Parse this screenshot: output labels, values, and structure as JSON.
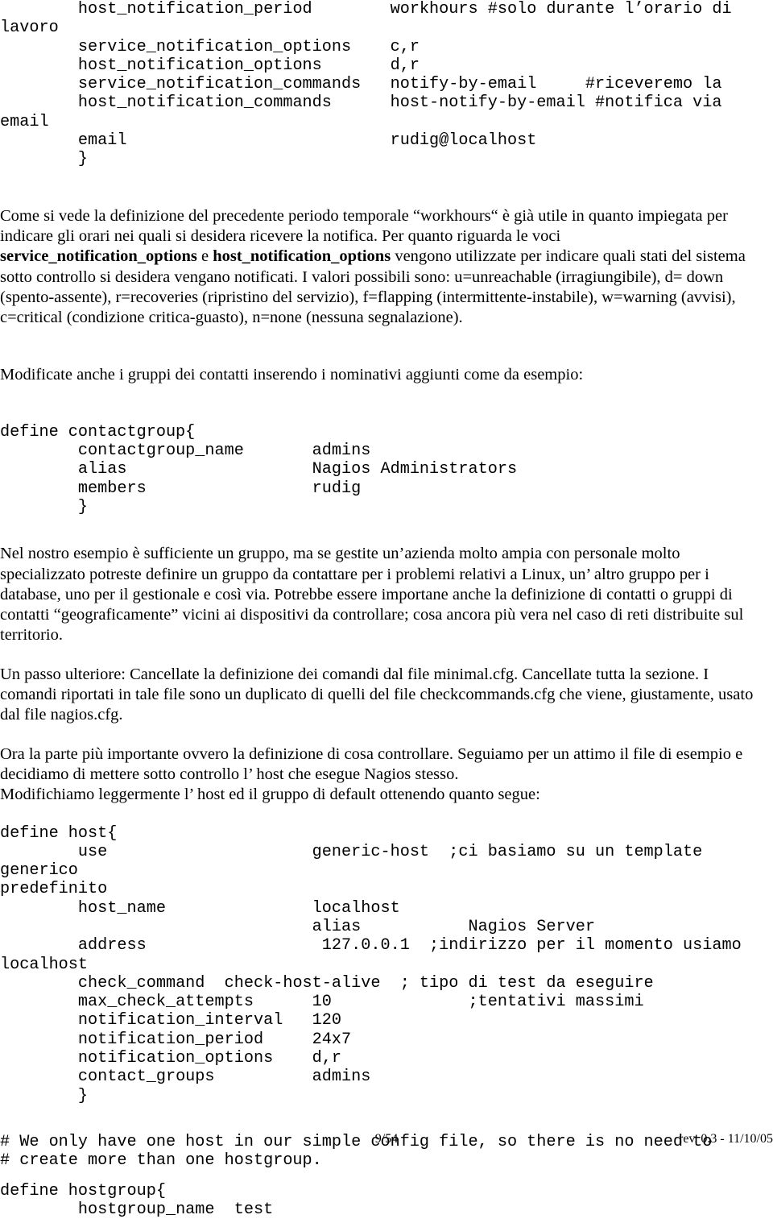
{
  "document": {
    "language": "it",
    "page_label": "9/54",
    "revision": "rev. 0.3 - 11/10/05"
  },
  "blocks": {
    "contact_block": {
      "kind": "code",
      "text": "        host_notification_period        workhours #solo durante l’orario di\nlavoro\n        service_notification_options    c,r\n        host_notification_options       d,r\n        service_notification_commands   notify-by-email     #riceveremo la\n        host_notification_commands      host-notify-by-email #notifica via email\n        email                           rudig@localhost\n        }"
    },
    "para_workhours": {
      "kind": "prose",
      "segments": [
        {
          "text": "Come si vede la definizione del precedente periodo temporale “workhours“ è già utile in quanto impiegata per indicare gli orari nei quali si desidera ricevere la notifica.  Per quanto riguarda le voci ",
          "bold": false
        },
        {
          "text": "service_notification_options",
          "bold": true
        },
        {
          "text": " e ",
          "bold": false
        },
        {
          "text": "host_notification_options",
          "bold": true
        },
        {
          "text": " vengono utilizzate per indicare quali stati del sistema sotto controllo si desidera vengano notificati.  I valori possibili sono: u=unreachable (irragiungibile), d= down (spento-assente), r=recoveries (ripristino del servizio), f=flapping (intermittente-instabile), w=warning (avvisi), c=critical (condizione critica-guasto), n=none (nessuna segnalazione).",
          "bold": false
        }
      ]
    },
    "para_contactgroup_intro": {
      "kind": "prose",
      "segments": [
        {
          "text": "Modificate anche i gruppi dei contatti inserendo i nominativi aggiunti come da esempio:",
          "bold": false
        }
      ]
    },
    "contactgroup_block": {
      "kind": "code",
      "text": "define contactgroup{\n        contactgroup_name       admins\n        alias                   Nagios Administrators\n        members                 rudig\n        }"
    },
    "para_gruppi": {
      "kind": "prose",
      "segments": [
        {
          "text": "Nel nostro esempio è sufficiente un gruppo, ma se gestite un’azienda molto ampia con personale molto specializzato potreste definire un gruppo da contattare per i problemi relativi a Linux, un’ altro gruppo per i database, uno per il gestionale e così via.  Potrebbe essere importane anche la definizione di contatti o gruppi di contatti “geograficamente” vicini ai dispositivi da controllare; cosa ancora più vera nel caso di reti distribuite sul territorio.",
          "bold": false
        }
      ]
    },
    "para_passo_ulteriore": {
      "kind": "prose",
      "segments": [
        {
          "text": "Un passo ulteriore: Cancellate la definizione dei comandi dal file minimal.cfg. Cancellate tutta la sezione. I comandi riportati in tale file sono un duplicato di quelli del file checkcommands.cfg che viene, giustamente, usato dal file nagios.cfg.",
          "bold": false
        }
      ]
    },
    "para_parte_importante": {
      "kind": "prose",
      "segments": [
        {
          "text": "Ora la parte più importante ovvero la definizione di cosa controllare. Seguiamo per un attimo il file di esempio e decidiamo di mettere sotto controllo l’ host che esegue Nagios stesso.",
          "bold": false
        }
      ]
    },
    "para_modifichiamo": {
      "kind": "prose",
      "segments": [
        {
          "text": "Modifichiamo leggermente l’ host ed il  gruppo di default ottenendo quanto segue:",
          "bold": false
        }
      ]
    },
    "host_block": {
      "kind": "code",
      "text": "define host{\n        use                     generic-host  ;ci basiamo su un template generico\npredefinito\n        host_name               localhost\n                                alias           Nagios Server\n        address                  127.0.0.1  ;indirizzo per il momento usiamo\nlocalhost\n        check_command  check-host-alive  ; tipo di test da eseguire\n        max_check_attempts      10              ;tentativi massimi\n        notification_interval   120\n        notification_period     24x7\n        notification_options    d,r\n        contact_groups          admins\n        }"
    },
    "hostgroup_comment": {
      "kind": "code",
      "text": "# We only have one host in our simple config file, so there is no need to\n# create more than one hostgroup."
    },
    "hostgroup_block": {
      "kind": "code",
      "text": "define hostgroup{\n        hostgroup_name  test"
    }
  }
}
